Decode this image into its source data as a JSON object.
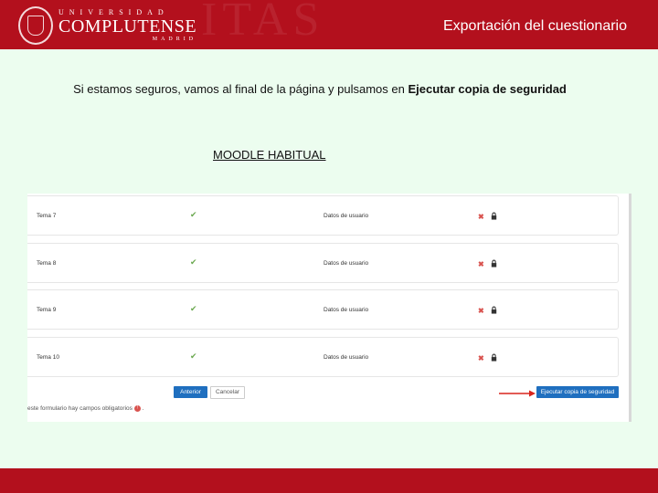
{
  "header": {
    "title": "Exportación del cuestionario",
    "logo": {
      "line1": "UNIVERSIDAD",
      "line2": "COMPLUTENSE",
      "line3": "MADRID"
    }
  },
  "instruction": {
    "before": "Si estamos seguros, vamos al final de la página y pulsamos en ",
    "bold": "Ejecutar copia de seguridad"
  },
  "subtitle": "MOODLE HABITUAL",
  "screenshot": {
    "rows": [
      {
        "name": "Tema 7",
        "data": "Datos de usuario"
      },
      {
        "name": "Tema 8",
        "data": "Datos de usuario"
      },
      {
        "name": "Tema 9",
        "data": "Datos de usuario"
      },
      {
        "name": "Tema 10",
        "data": "Datos de usuario"
      }
    ],
    "buttons": {
      "prev": "Anterior",
      "cancel": "Cancelar",
      "backup": "Ejecutar copia de seguridad"
    },
    "note": "este formulario hay campos obligatorios",
    "note_suffix": "."
  },
  "colors": {
    "brand": "#b3101d",
    "background": "#ecfdef",
    "button": "#1f6fbf"
  }
}
